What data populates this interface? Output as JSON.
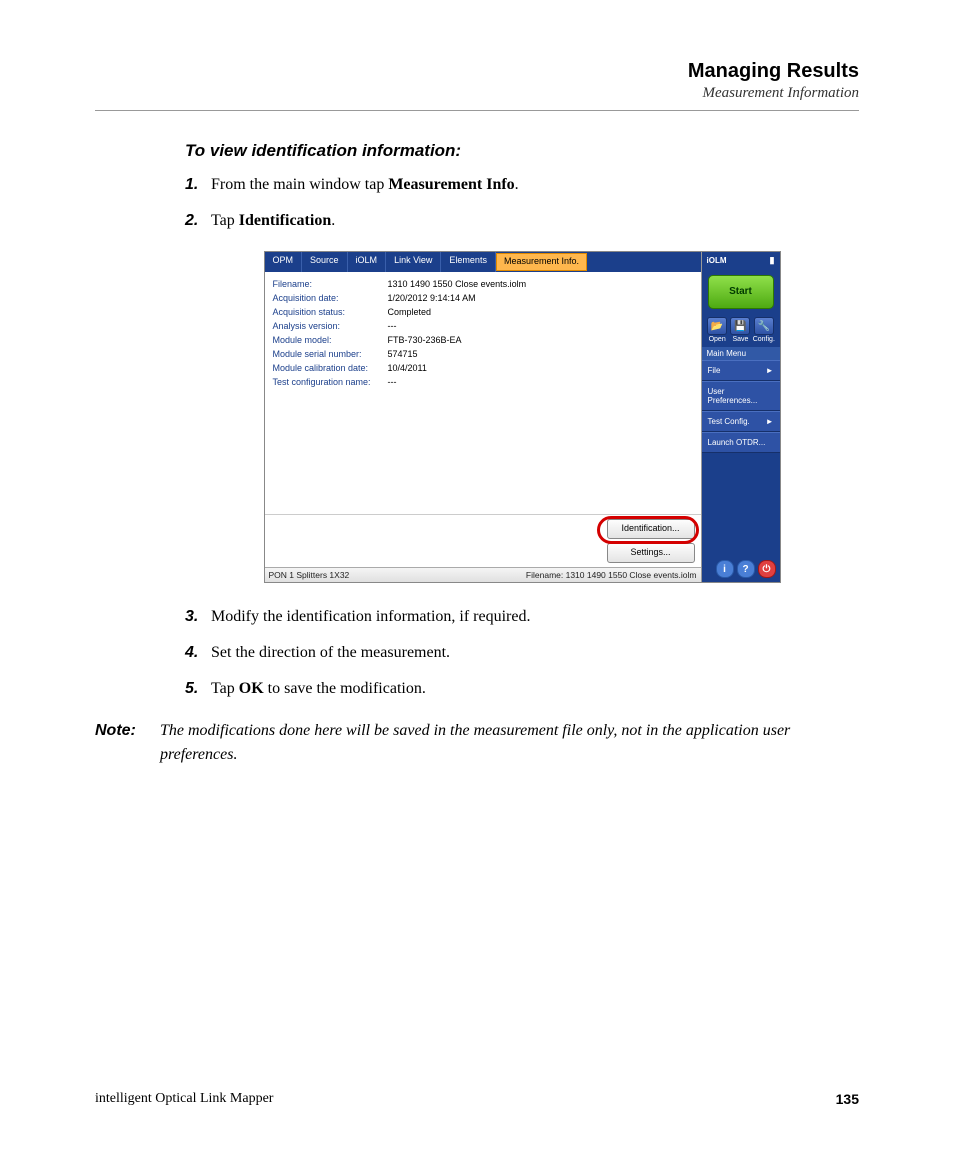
{
  "header": {
    "title": "Managing Results",
    "subtitle": "Measurement Information"
  },
  "procedure": {
    "title": "To view identification information:",
    "steps": [
      {
        "num": "1.",
        "pre": "From the main window tap ",
        "bold": "Measurement Info",
        "post": "."
      },
      {
        "num": "2.",
        "pre": "Tap ",
        "bold": "Identification",
        "post": "."
      }
    ],
    "steps_after": [
      {
        "num": "3.",
        "pre": "Modify the identification information, if required.",
        "bold": "",
        "post": ""
      },
      {
        "num": "4.",
        "pre": "Set the direction of the measurement.",
        "bold": "",
        "post": ""
      },
      {
        "num": "5.",
        "pre": "Tap ",
        "bold": "OK",
        "post": " to save the modification."
      }
    ]
  },
  "note": {
    "label": "Note:",
    "text": "The modifications done here will be saved in the measurement file only, not in the application user preferences."
  },
  "screenshot": {
    "tabs": [
      "OPM",
      "Source",
      "iOLM",
      "Link View",
      "Elements",
      "Measurement Info."
    ],
    "info_rows": [
      {
        "label": "Filename:",
        "value": "1310 1490 1550 Close events.iolm"
      },
      {
        "label": "Acquisition date:",
        "value": "1/20/2012 9:14:14 AM"
      },
      {
        "label": "Acquisition status:",
        "value": "Completed"
      },
      {
        "label": "Analysis version:",
        "value": "---"
      },
      {
        "label": "Module model:",
        "value": "FTB-730-236B-EA"
      },
      {
        "label": "Module serial number:",
        "value": "574715"
      },
      {
        "label": "Module calibration date:",
        "value": "10/4/2011"
      },
      {
        "label": "Test configuration name:",
        "value": "---"
      }
    ],
    "buttons": {
      "identification": "Identification...",
      "settings": "Settings..."
    },
    "status": {
      "left": "PON 1 Splitters 1X32",
      "right": "Filename: 1310 1490 1550 Close events.iolm"
    },
    "side": {
      "title": "iOLM",
      "start": "Start",
      "icons": [
        {
          "glyph": "📂",
          "label": "Open"
        },
        {
          "glyph": "💾",
          "label": "Save"
        },
        {
          "glyph": "🔧",
          "label": "Config."
        }
      ],
      "menu_header": "Main Menu",
      "menu": [
        {
          "label": "File",
          "chev": "►"
        },
        {
          "label": "User Preferences...",
          "chev": ""
        },
        {
          "label": "Test Config.",
          "chev": "►"
        },
        {
          "label": "Launch OTDR...",
          "chev": ""
        }
      ],
      "bottom": {
        "info": "i",
        "help": "?",
        "close": "⏻"
      }
    }
  },
  "footer": {
    "product": "intelligent Optical Link Mapper",
    "page": "135"
  }
}
